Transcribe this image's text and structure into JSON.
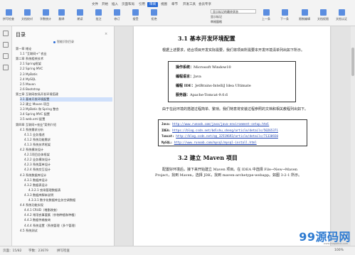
{
  "ribbon": {
    "menu_tabs": [
      "文件",
      "开始",
      "插入",
      "页面布局",
      "引用",
      "审阅",
      "视图",
      "章节",
      "开发工具",
      "会员专享"
    ],
    "active_tab_index": 5,
    "tools": [
      "拼写检查",
      "文档校对",
      "字数统计",
      "翻译",
      "朗读",
      "批注",
      "修订",
      "接受",
      "拒绝",
      "上一条",
      "下一条",
      "限制编辑",
      "文档权限",
      "文档认证"
    ],
    "view_dropdown": "显示标记的最终状态",
    "show_markup": "显示标记",
    "review_pane": "审阅窗格",
    "prev_item": "上一条",
    "next_item": "下一条"
  },
  "outline": {
    "title": "目录",
    "smart_outline": "智能识别目录",
    "items": [
      {
        "text": "第一章 绪论",
        "indent": 0,
        "selected": false
      },
      {
        "text": "1.1 \"互联网+\" 农业",
        "indent": 1,
        "selected": false
      },
      {
        "text": "第二章 系统相关技术",
        "indent": 0,
        "selected": false
      },
      {
        "text": "2.1 Spring框架",
        "indent": 1,
        "selected": false
      },
      {
        "text": "2.2 Spring MVC",
        "indent": 1,
        "selected": false
      },
      {
        "text": "2.3 MyBatis",
        "indent": 1,
        "selected": false
      },
      {
        "text": "2.4 MySQL",
        "indent": 1,
        "selected": false
      },
      {
        "text": "2.5 Maven",
        "indent": 1,
        "selected": false
      },
      {
        "text": "2.6 Bootstrap",
        "indent": 1,
        "selected": false
      },
      {
        "text": "第三章 互联网农场开发环境搭建",
        "indent": 0,
        "selected": false
      },
      {
        "text": "3.1 基本开发环境配置",
        "indent": 1,
        "selected": true
      },
      {
        "text": "3.2 建立 Maven 项目",
        "indent": 1,
        "selected": false
      },
      {
        "text": "3.3 MyBatis 和 Spring 整合",
        "indent": 1,
        "selected": false
      },
      {
        "text": "3.4 Spring MVC 配置",
        "indent": 1,
        "selected": false
      },
      {
        "text": "3.5 web.xml 配置",
        "indent": 1,
        "selected": false
      },
      {
        "text": "第四章 互联网+农业\"案例介绍",
        "indent": 0,
        "selected": false
      },
      {
        "text": "4.1 系统需求分析",
        "indent": 1,
        "selected": false
      },
      {
        "text": "4.1.1 业务描述",
        "indent": 2,
        "selected": false
      },
      {
        "text": "4.1.2 系统功能需求",
        "indent": 2,
        "selected": false
      },
      {
        "text": "4.1.3 系统技术框架",
        "indent": 2,
        "selected": false
      },
      {
        "text": "4.2 系统模块设计",
        "indent": 1,
        "selected": false
      },
      {
        "text": "4.2.1项目总体框架",
        "indent": 2,
        "selected": false
      },
      {
        "text": "4.2.2 业务模块设计",
        "indent": 2,
        "selected": false
      },
      {
        "text": "4.2.3 系统菜单设计",
        "indent": 2,
        "selected": false
      },
      {
        "text": "4.2.4 系统交互设计",
        "indent": 2,
        "selected": false
      },
      {
        "text": "4.3 系统数据库设计",
        "indent": 1,
        "selected": false
      },
      {
        "text": "4.3.1 数据库设计",
        "indent": 2,
        "selected": false
      },
      {
        "text": "4.3.2 数据表设计",
        "indent": 2,
        "selected": false
      },
      {
        "text": "4.3.2.1 农场管理数据表",
        "indent": 3,
        "selected": false
      },
      {
        "text": "4.3.3 数据库脚本说明",
        "indent": 2,
        "selected": false
      },
      {
        "text": "4.3.3.1 数字化数据库业务空调数据",
        "indent": 3,
        "selected": false
      },
      {
        "text": "4.4 系统功能实现",
        "indent": 1,
        "selected": false
      },
      {
        "text": "4.4.1 CRUD（增删改查）",
        "indent": 2,
        "selected": false
      },
      {
        "text": "4.4.2 常用农事要素（作物种植和种植）",
        "indent": 2,
        "selected": false
      },
      {
        "text": "4.4.3 数据传输查询",
        "indent": 2,
        "selected": false
      },
      {
        "text": "4.4.4 系统设置（系统管理（多个管理）",
        "indent": 2,
        "selected": false
      },
      {
        "text": "4.5 系统测试",
        "indent": 1,
        "selected": false
      }
    ]
  },
  "document": {
    "section1_title": "3.1 基本开发环境配置",
    "section1_para": "根据上述要求，结合项目开发实际需要，我们将项目所需要本开发环境清单列出如下所示。",
    "env": [
      {
        "label": "操作系统：",
        "value": "Microsoft Window10"
      },
      {
        "label": "编程语言：",
        "value": "Java"
      },
      {
        "label": "编程 IDE：",
        "value": "JetBrains-IntelliJ Idea Ultimate"
      },
      {
        "label": "服务器：",
        "value": "Apache-Tomcat-9.0.6"
      }
    ],
    "middle_para": "由于在此环境的搭建过程简单、繁琐。我们特意将安装过程参照的文档和相关教程列出如下。",
    "links": [
      {
        "label": "Java:",
        "url": "http://www.runoob.com/java/java-environment-setup.html"
      },
      {
        "label": "IDEA:",
        "url": "https://blog.csdn.net/bdlshu_sheng/article/details/50265371"
      },
      {
        "label": "Tomcat:",
        "url": "http://blog.csdn.net/qq_32519693/article/details/71330920"
      },
      {
        "label": "MySQL:",
        "url": "http://www.runoob.com/mysql/mysql-install.html"
      }
    ],
    "section2_title": "3.2 建立 Maven 项目",
    "section2_para": "配置好环境后，接下来开始建立 Maven 项目。在 IDEA 中选择 File→New→Maven Project，找到 Maven，选择 JDK，找到 maven-archetype-webapp。如图 3-2-1 所示。"
  },
  "status": {
    "page": "页面：15/82",
    "words": "字数：23679",
    "spell": "拼写检查",
    "zoom": "100%"
  },
  "watermark": {
    "text": "99源码网",
    "sub": "www.mapofice.com"
  }
}
